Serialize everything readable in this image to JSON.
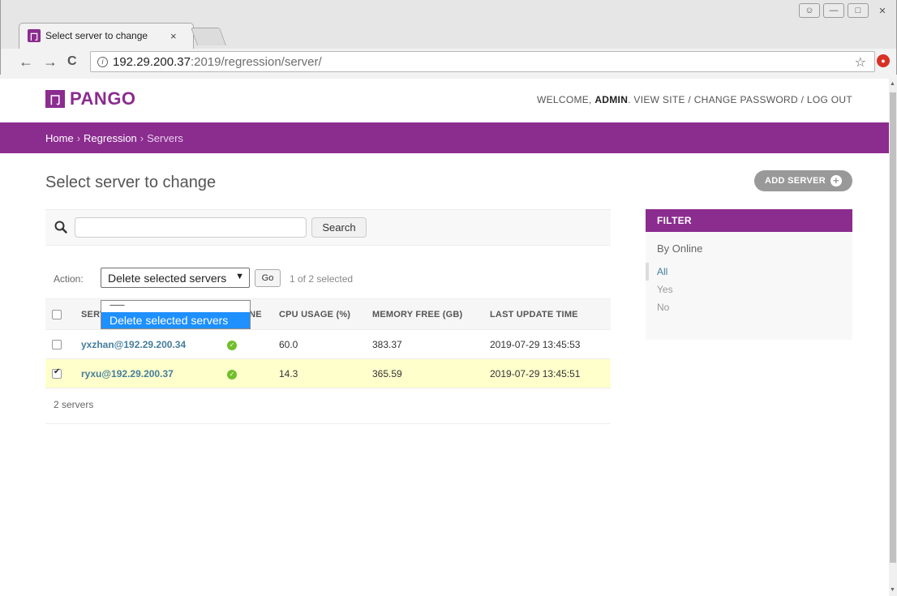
{
  "browser": {
    "tab_title": "Select server to change",
    "tab_close": "×",
    "url_host": "192.29.200.37",
    "url_path": ":2019/regression/server/",
    "back_icon": "←",
    "forward_icon": "→",
    "reload_icon": "C",
    "star_icon": "☆"
  },
  "header": {
    "brand": "PANGO",
    "brand_logo": "冂",
    "welcome_prefix": "WELCOME, ",
    "user": "ADMIN",
    "links": ". VIEW SITE / CHANGE PASSWORD / LOG OUT"
  },
  "breadcrumbs": {
    "home": "Home",
    "app": "Regression",
    "current": "Servers",
    "sep": "›"
  },
  "content": {
    "title": "Select server to change",
    "add_label": "ADD SERVER",
    "add_icon": "+"
  },
  "search": {
    "value": "",
    "button": "Search"
  },
  "actions": {
    "label": "Action:",
    "selected": "Delete selected servers",
    "go": "Go",
    "counter": "1 of 2 selected",
    "options": [
      "---------",
      "Delete selected servers"
    ]
  },
  "table": {
    "headers": [
      "SERVER",
      "ONLINE",
      "CPU USAGE (%)",
      "MEMORY FREE (GB)",
      "LAST UPDATE TIME"
    ],
    "rows": [
      {
        "server": "yxzhan@192.29.200.34",
        "online": true,
        "cpu": "60.0",
        "memory": "383.37",
        "updated": "2019-07-29 13:45:53",
        "checked": false
      },
      {
        "server": "ryxu@192.29.200.37",
        "online": true,
        "cpu": "14.3",
        "memory": "365.59",
        "updated": "2019-07-29 13:45:51",
        "checked": true
      }
    ],
    "count": "2 servers"
  },
  "filter": {
    "title": "FILTER",
    "subtitle": "By Online",
    "items": [
      "All",
      "Yes",
      "No"
    ]
  },
  "colors": {
    "brand": "#8b2c8f",
    "link": "#447e9b",
    "selected_row": "#ffffcc",
    "dropdown_highlight": "#1e90ff"
  }
}
